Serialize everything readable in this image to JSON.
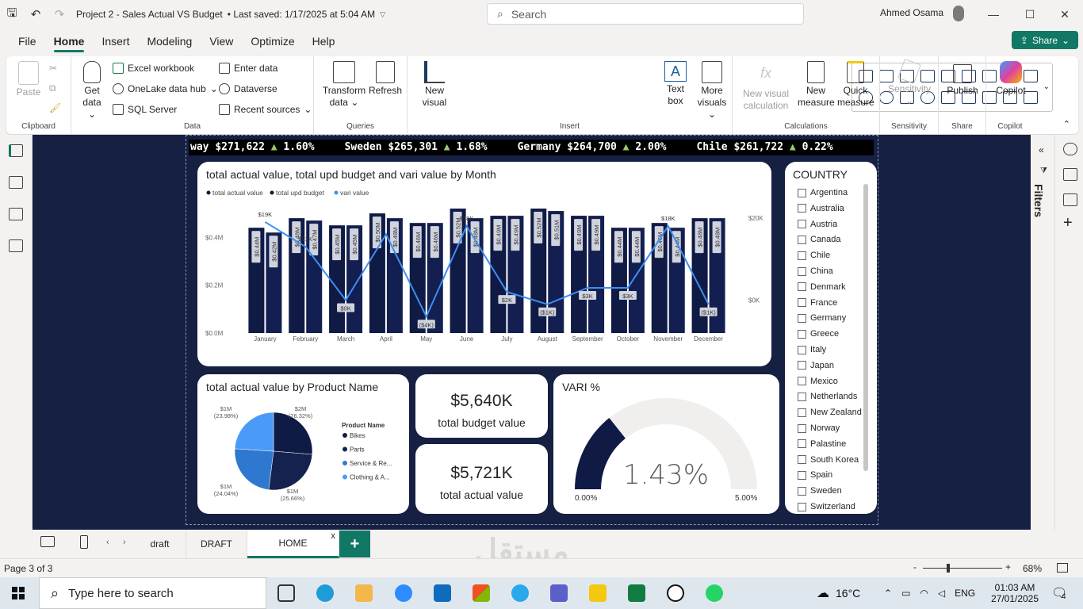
{
  "titlebar": {
    "title": "Project 2 - Sales Actual VS Budget",
    "saved": "• Last saved: 1/17/2025 at 5:04 AM",
    "search_placeholder": "Search",
    "user": "Ahmed Osama"
  },
  "menu": {
    "items": [
      "File",
      "Home",
      "Insert",
      "Modeling",
      "View",
      "Optimize",
      "Help"
    ],
    "active": "Home",
    "share_label": "Share"
  },
  "ribbon": {
    "clipboard": {
      "paste": "Paste",
      "group": "Clipboard"
    },
    "data": {
      "get_data": "Get",
      "get_data2": "data",
      "excel": "Excel workbook",
      "onelake": "OneLake data hub",
      "sql": "SQL Server",
      "enter": "Enter data",
      "dataverse": "Dataverse",
      "recent": "Recent sources",
      "group": "Data"
    },
    "queries": {
      "transform": "Transform",
      "transform2": "data",
      "refresh": "Refresh",
      "group": "Queries"
    },
    "insert": {
      "new_visual": "New",
      "new_visual2": "visual",
      "text_box": "Text",
      "text_box2": "box",
      "more_visuals": "More",
      "more_visuals2": "visuals",
      "group": "Insert"
    },
    "calculations": {
      "new_visual_calc": "New visual",
      "new_visual_calc2": "calculation",
      "new_measure": "New",
      "new_measure2": "measure",
      "quick_measure": "Quick",
      "quick_measure2": "measure",
      "group": "Calculations"
    },
    "sensitivity": {
      "label": "Sensitivity",
      "group": "Sensitivity"
    },
    "share": {
      "publish": "Publish",
      "group": "Share"
    },
    "copilot": {
      "label": "Copilot",
      "group": "Copilot"
    }
  },
  "ticker": [
    {
      "name": "way",
      "value": "$271,622",
      "change": "1.60%"
    },
    {
      "name": "Sweden",
      "value": "$265,301",
      "change": "1.68%"
    },
    {
      "name": "Germany",
      "value": "$264,700",
      "change": "2.00%"
    },
    {
      "name": "Chile",
      "value": "$261,722",
      "change": "0.22%"
    }
  ],
  "chart_data": [
    {
      "type": "bar",
      "title": "total actual value, total upd budget and vari value by Month",
      "legend": [
        "total actual value",
        "total upd budget",
        "vari value"
      ],
      "categories": [
        "January",
        "February",
        "March",
        "April",
        "May",
        "June",
        "July",
        "August",
        "September",
        "October",
        "November",
        "December"
      ],
      "series": [
        {
          "name": "total actual value",
          "values": [
            0.44,
            0.48,
            0.45,
            0.5,
            0.46,
            0.52,
            0.49,
            0.52,
            0.49,
            0.44,
            0.46,
            0.48
          ],
          "labels": [
            "$0.44M",
            "$0.48M",
            "$0.45M",
            "$0.50M",
            "$0.46M",
            "$0.52M",
            "$0.49M",
            "$0.52M",
            "$0.49M",
            "$0.44M",
            "$0.46M",
            "$0.48M"
          ]
        },
        {
          "name": "total upd budget",
          "values": [
            0.42,
            0.47,
            0.45,
            0.48,
            0.46,
            0.48,
            0.49,
            0.51,
            0.49,
            0.44,
            0.44,
            0.48
          ],
          "labels": [
            "$0.42M",
            "$0.47M",
            "$0.45M",
            "$0.48M",
            "$0.46M",
            "$0.48M",
            "$0.49M",
            "$0.51M",
            "$0.49M",
            "$0.44M",
            "$0.44M",
            "$0.48M"
          ]
        },
        {
          "name": "vari value",
          "values": [
            19,
            13,
            0,
            16,
            -4,
            18,
            2,
            -1,
            3,
            3,
            18,
            -1
          ],
          "labels": [
            "$19K",
            "$13K",
            "$0K",
            "",
            "($4K)",
            "$18K",
            "$2K",
            "($1K)",
            "$3K",
            "$3K",
            "$18K",
            "($1K)"
          ]
        }
      ],
      "y_ticks": [
        "$0.0M",
        "$0.2M",
        "$0.4M"
      ],
      "y2_ticks": [
        "$0K",
        "$20K"
      ],
      "ylim": [
        0,
        0.55
      ],
      "y2lim": [
        -8,
        24
      ],
      "colors": {
        "actual": "#0f1a45",
        "budget": "#121f50",
        "vari": "#3d8ef0"
      }
    },
    {
      "type": "pie",
      "title": "total actual value by Product Name",
      "legend_title": "Product Name",
      "slices": [
        {
          "name": "Bikes",
          "value": 26.32,
          "label": "$2M",
          "pct": "(26.32%)",
          "color": "#0f1a45"
        },
        {
          "name": "Parts",
          "value": 25.66,
          "label": "$1M",
          "pct": "(25.66%)",
          "color": "#15224f"
        },
        {
          "name": "Service & Re...",
          "value": 24.04,
          "label": "$1M",
          "pct": "(24.04%)",
          "color": "#2f78d0"
        },
        {
          "name": "Clothing & A...",
          "value": 23.98,
          "label": "$1M",
          "pct": "(23.98%)",
          "color": "#4a9bf7"
        }
      ]
    }
  ],
  "kpis": [
    {
      "value": "$5,640K",
      "label": "total budget value"
    },
    {
      "value": "$5,721K",
      "label": "total actual value"
    }
  ],
  "gauge": {
    "title": "VARI %",
    "value": 1.43,
    "display": "1.43%",
    "min": "0.00%",
    "max": "5.00%",
    "min_value": 0,
    "max_value": 5
  },
  "slicer": {
    "title": "COUNTRY",
    "items": [
      "Argentina",
      "Australia",
      "Austria",
      "Canada",
      "Chile",
      "China",
      "Denmark",
      "France",
      "Germany",
      "Greece",
      "Italy",
      "Japan",
      "Mexico",
      "Netherlands",
      "New Zealand",
      "Norway",
      "Palastine",
      "South Korea",
      "Spain",
      "Sweden",
      "Switzerland"
    ]
  },
  "filters_label": "Filters",
  "tabs": [
    {
      "label": "draft"
    },
    {
      "label": "DRAFT"
    },
    {
      "label": "HOME",
      "close": "x",
      "active": true
    }
  ],
  "statusbar": {
    "page": "Page 3 of 3",
    "zoom": "68%"
  },
  "taskbar": {
    "search_placeholder": "Type here to search",
    "temp": "16°C",
    "lang": "ENG",
    "time": "01:03 AM",
    "date": "27/01/2025",
    "notif": "4"
  },
  "watermark": "مستقل"
}
